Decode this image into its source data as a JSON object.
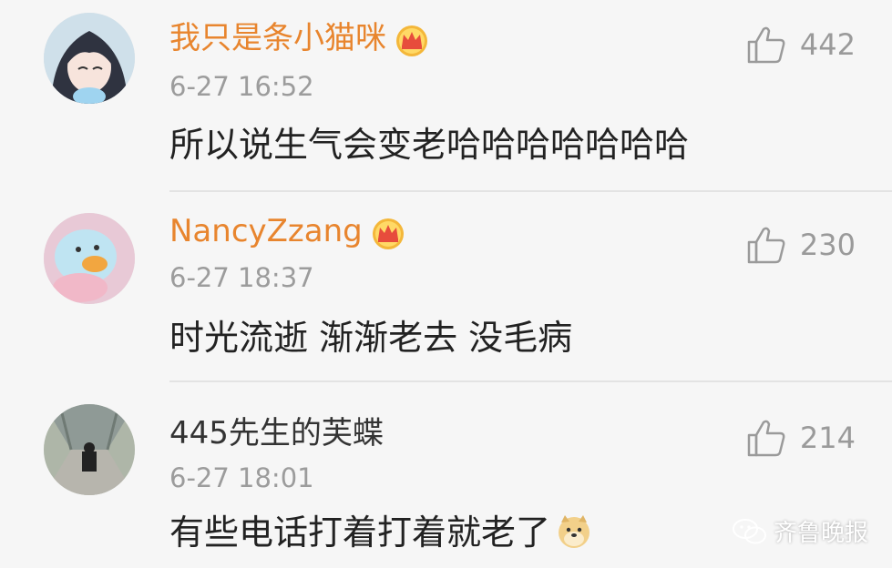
{
  "comments": [
    {
      "username": "我只是条小猫咪",
      "verified_badge": "crown-icon",
      "time": "6-27 16:52",
      "content": "所以说生气会变老哈哈哈哈哈哈哈",
      "likes": "442"
    },
    {
      "username": "NancyZzang",
      "verified_badge": "crown-icon",
      "time": "6-27 18:37",
      "content": "时光流逝 渐渐老去 没毛病",
      "likes": "230"
    },
    {
      "username": "445先生的芙蝶",
      "time": "6-27 18:01",
      "content": "有些电话打着打着就老了",
      "content_emoji": "doge-emoji",
      "likes": "214"
    }
  ],
  "watermark": {
    "icon": "wechat-icon",
    "text": "齐鲁晚报"
  },
  "colors": {
    "username_vip": "#e8852e",
    "username_plain": "#333333",
    "time": "#9c9c9c",
    "like": "#9a9a9a",
    "background": "#f6f6f6"
  }
}
